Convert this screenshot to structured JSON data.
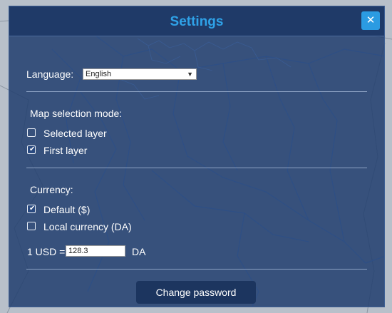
{
  "dialog": {
    "title": "Settings",
    "close_label": "✕"
  },
  "language": {
    "label": "Language:",
    "selected": "English"
  },
  "map_selection": {
    "label": "Map selection mode:",
    "options": [
      {
        "label": "Selected layer",
        "checked": false
      },
      {
        "label": "First layer",
        "checked": true
      }
    ]
  },
  "currency": {
    "label": "Currency:",
    "options": [
      {
        "label": "Default ($)",
        "checked": true
      },
      {
        "label": "Local currency (DA)",
        "checked": false
      }
    ],
    "rate_prefix": "1 USD =",
    "rate_value": "128.3",
    "rate_suffix": "DA"
  },
  "actions": {
    "change_password": "Change password"
  },
  "colors": {
    "accent": "#2fa2e8",
    "dialog_bg": "#223f6f",
    "button_bg": "#1c355f"
  }
}
